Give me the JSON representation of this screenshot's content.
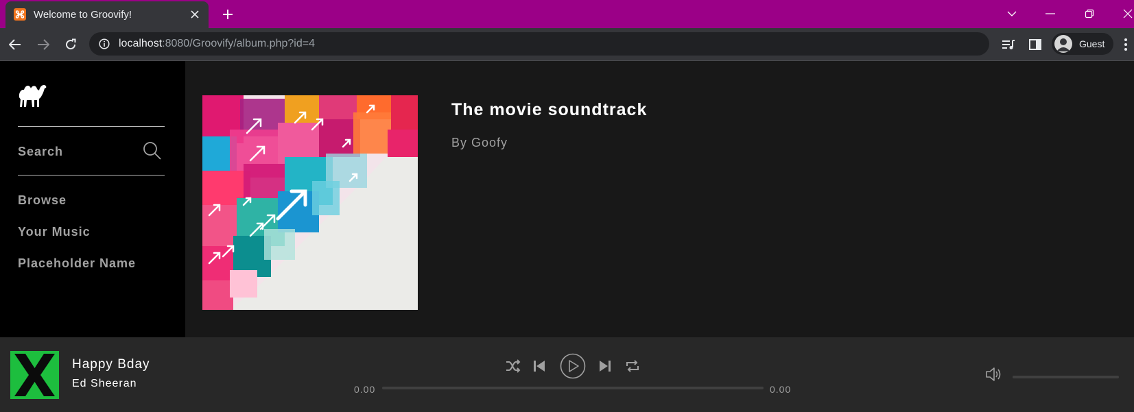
{
  "browser": {
    "tab_title": "Welcome to Groovify!",
    "url_host": "localhost",
    "url_rest": ":8080/Groovify/album.php?id=4",
    "profile_label": "Guest"
  },
  "sidebar": {
    "search_label": "Search",
    "nav_items": [
      {
        "label": "Browse"
      },
      {
        "label": "Your Music"
      },
      {
        "label": "Placeholder Name"
      }
    ]
  },
  "album": {
    "title": "The movie soundtrack",
    "artist": "By Goofy"
  },
  "player": {
    "track_title": "Happy Bday",
    "track_artist": "Ed Sheeran",
    "time_current": "0.00",
    "time_total": "0.00",
    "progress_fraction": 0,
    "volume_fraction": 0
  },
  "colors": {
    "tab_strip": "#9b0087",
    "sidebar_bg": "#000000",
    "main_bg": "#181818",
    "player_bg": "#282828",
    "now_playing_art": "#1dbe3e"
  }
}
